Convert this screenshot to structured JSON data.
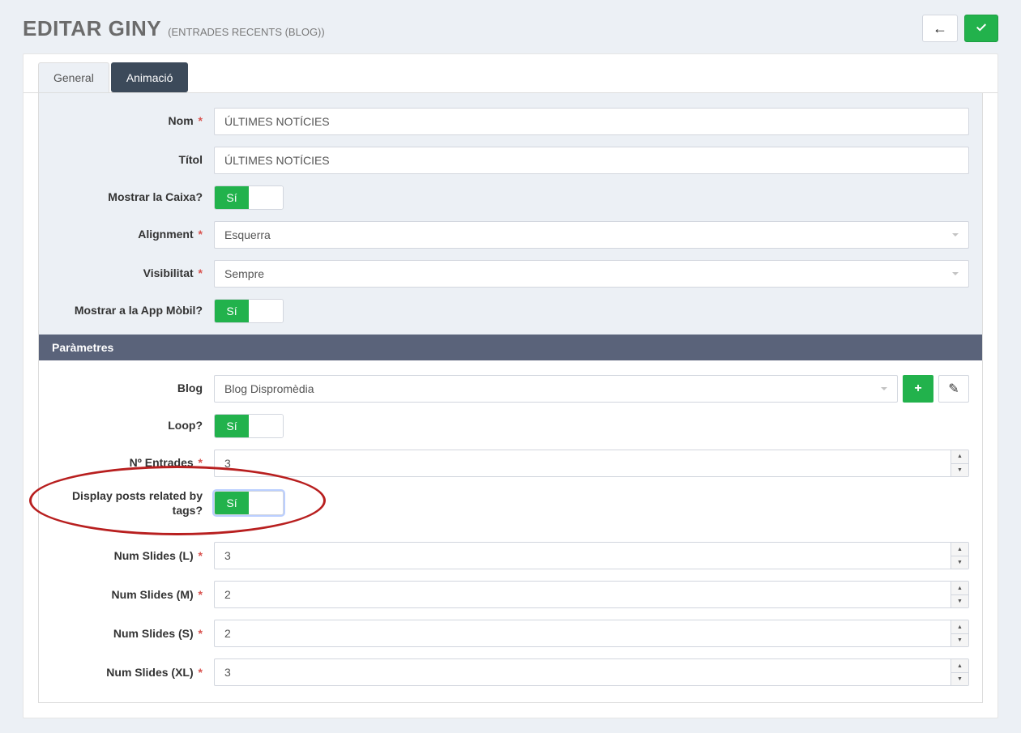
{
  "header": {
    "title": "EDITAR GINY",
    "subtitle": "(ENTRADES RECENTS (BLOG))"
  },
  "tabs": {
    "general": "General",
    "animation": "Animació"
  },
  "labels": {
    "nom": "Nom",
    "titol": "Títol",
    "mostrar_caixa": "Mostrar la Caixa?",
    "alignment": "Alignment",
    "visibilitat": "Visibilitat",
    "mostrar_app": "Mostrar a la App Mòbil?",
    "parametres": "Paràmetres",
    "blog": "Blog",
    "loop": "Loop?",
    "n_entrades": "Nº Entrades",
    "posts_related": "Display posts related by tags?",
    "slides_l": "Num Slides (L)",
    "slides_m": "Num Slides (M)",
    "slides_s": "Num Slides (S)",
    "slides_xl": "Num Slides (XL)"
  },
  "values": {
    "nom": "ÚLTIMES NOTÍCIES",
    "titol": "ÚLTIMES NOTÍCIES",
    "toggle_on": "Sí",
    "alignment": "Esquerra",
    "visibilitat": "Sempre",
    "blog": "Blog Dispromèdia",
    "n_entrades": "3",
    "slides_l": "3",
    "slides_m": "2",
    "slides_s": "2",
    "slides_xl": "3"
  },
  "req": "*"
}
